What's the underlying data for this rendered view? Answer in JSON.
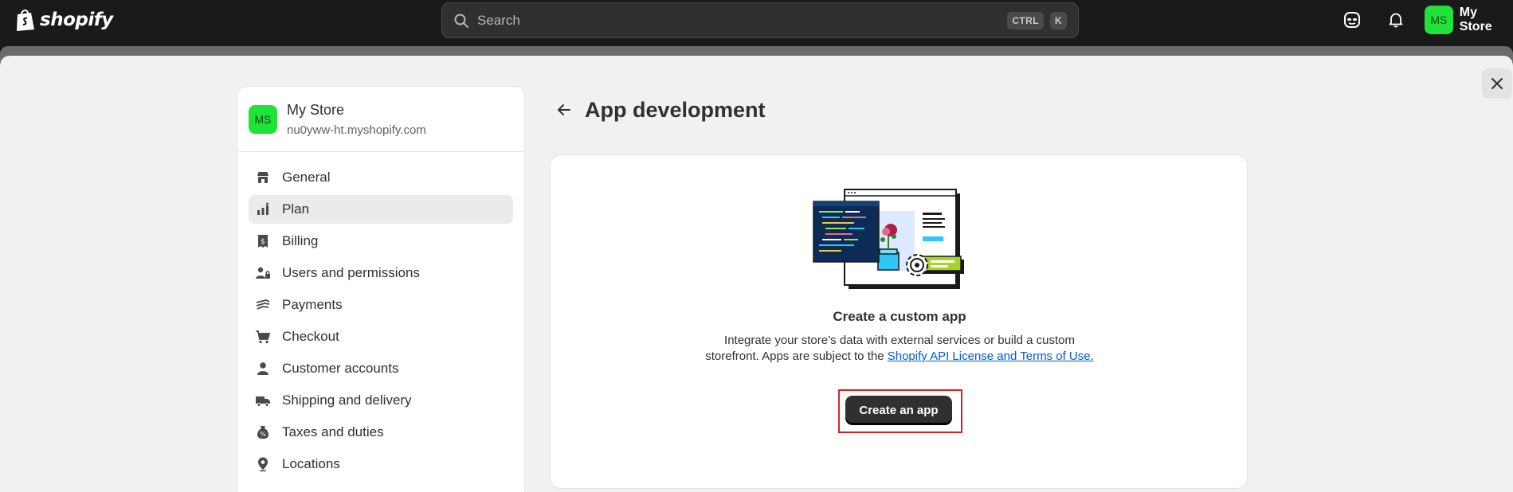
{
  "topbar": {
    "logo_text": "shopify",
    "search": {
      "placeholder": "Search",
      "shortcut_keys": [
        "CTRL",
        "K"
      ]
    },
    "icons": [
      "incognito-icon",
      "bell-icon"
    ],
    "store": {
      "initials": "MS",
      "name": "My Store"
    }
  },
  "sidebar": {
    "store": {
      "initials": "MS",
      "name": "My Store",
      "domain": "nu0yww-ht.myshopify.com"
    },
    "items": [
      {
        "label": "General",
        "icon": "store-icon",
        "active": false
      },
      {
        "label": "Plan",
        "icon": "plan-icon",
        "active": true
      },
      {
        "label": "Billing",
        "icon": "billing-icon",
        "active": false
      },
      {
        "label": "Users and permissions",
        "icon": "users-icon",
        "active": false
      },
      {
        "label": "Payments",
        "icon": "payments-icon",
        "active": false
      },
      {
        "label": "Checkout",
        "icon": "cart-icon",
        "active": false
      },
      {
        "label": "Customer accounts",
        "icon": "person-icon",
        "active": false
      },
      {
        "label": "Shipping and delivery",
        "icon": "truck-icon",
        "active": false
      },
      {
        "label": "Taxes and duties",
        "icon": "tax-icon",
        "active": false
      },
      {
        "label": "Locations",
        "icon": "location-icon",
        "active": false
      }
    ]
  },
  "main": {
    "title": "App development",
    "card": {
      "heading": "Create a custom app",
      "body_text": "Integrate your store’s data with external services or build a custom storefront. Apps are subject to the ",
      "link_text": "Shopify API License and Terms of Use.",
      "button_label": "Create an app"
    }
  },
  "colors": {
    "accent_green": "#1fe23a",
    "link_blue": "#005bd3",
    "highlight_red": "#e02020",
    "primary_button": "#303030"
  }
}
